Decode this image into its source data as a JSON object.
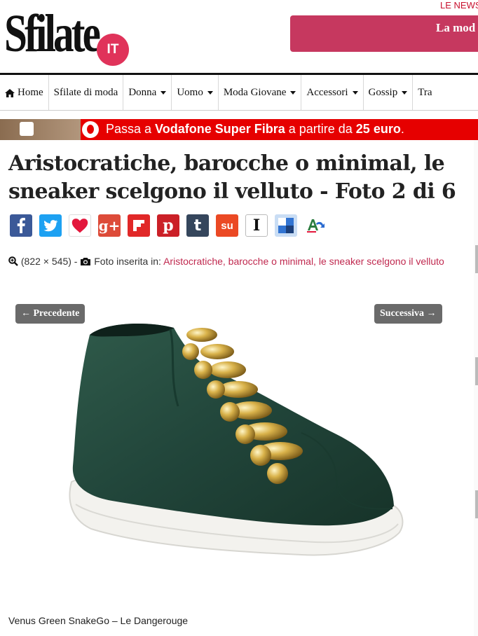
{
  "header": {
    "logo_text": "Sfilate",
    "logo_badge": "IT",
    "news_tag": "LE NEWS",
    "banner_text": "La mod"
  },
  "nav": {
    "items": [
      {
        "label": "Home",
        "icon": "home-icon",
        "dropdown": false
      },
      {
        "label": "Sfilate di moda",
        "dropdown": false
      },
      {
        "label": "Donna",
        "dropdown": true
      },
      {
        "label": "Uomo",
        "dropdown": true
      },
      {
        "label": "Moda Giovane",
        "dropdown": true
      },
      {
        "label": "Accessori",
        "dropdown": true
      },
      {
        "label": "Gossip",
        "dropdown": true
      },
      {
        "label": "Tra",
        "dropdown": false
      }
    ]
  },
  "ad": {
    "text_prefix": "Passa a ",
    "brand": "Vodafone Super Fibra",
    "text_mid": " a partire da ",
    "price": "25 euro",
    "text_suffix": "."
  },
  "article": {
    "title": "Aristocratiche, barocche o minimal, le sneaker scelgono il velluto - Foto 2 di 6",
    "dimensions": "(822 × 545) -",
    "inserted_label": "Foto inserita in:",
    "inserted_link": "Aristocratiche, barocche o minimal, le sneaker scelgono il velluto",
    "prev_label": "← Precedente",
    "next_label": "Successiva →",
    "caption": "Venus Green SnakeGo – Le Dangerouge"
  },
  "share": [
    {
      "name": "facebook-icon",
      "glyph": "f",
      "color": "#3b5998"
    },
    {
      "name": "twitter-icon",
      "glyph": "t",
      "color": "#1da1f2"
    },
    {
      "name": "heart-icon",
      "glyph": "♥",
      "color": "#ffffff"
    },
    {
      "name": "google-plus-icon",
      "glyph": "g+",
      "color": "#dd4b39"
    },
    {
      "name": "flipboard-icon",
      "glyph": "f",
      "color": "#e12828"
    },
    {
      "name": "pinterest-icon",
      "glyph": "p",
      "color": "#cb2027"
    },
    {
      "name": "tumblr-icon",
      "glyph": "t",
      "color": "#35465c"
    },
    {
      "name": "stumbleupon-icon",
      "glyph": "su",
      "color": "#eb4924"
    },
    {
      "name": "instapaper-icon",
      "glyph": "I",
      "color": "#ffffff"
    },
    {
      "name": "delicious-icon",
      "glyph": "d",
      "color": "#3274d2"
    },
    {
      "name": "translate-icon",
      "glyph": "A",
      "color": "#ffffff"
    }
  ],
  "colors": {
    "accent": "#c0294f",
    "nav_border": "#111111",
    "ad_red": "#e60000",
    "button_grey": "#6a6a6a"
  }
}
